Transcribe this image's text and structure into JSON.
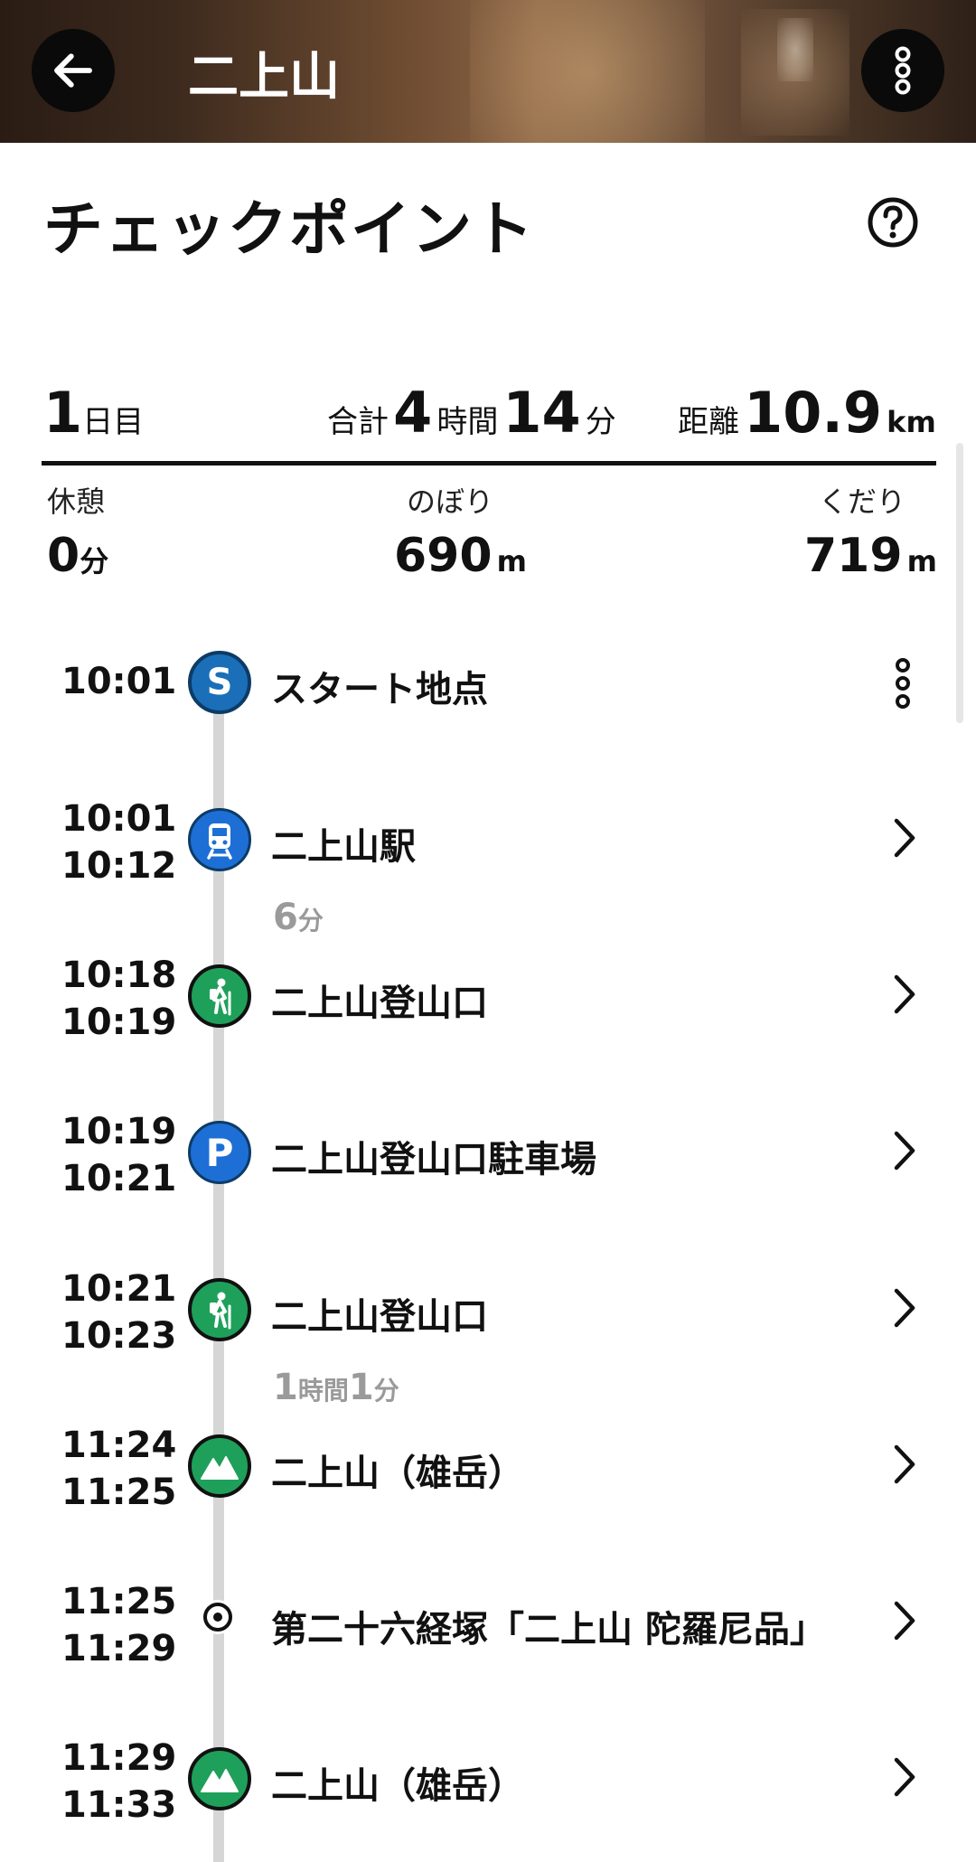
{
  "header": {
    "title": "二上山"
  },
  "page_title": "チェックポイント",
  "summary": {
    "day_number": "1",
    "day_unit": "日目",
    "total_label": "合計",
    "hours": "4",
    "hours_unit": "時間",
    "minutes": "14",
    "minutes_unit": "分",
    "distance_label": "距離",
    "distance": "10.9",
    "distance_unit": "km",
    "rest_label": "休憩",
    "rest_value": "0",
    "rest_unit": "分",
    "ascent_label": "のぼり",
    "ascent_value": "690",
    "ascent_unit": "m",
    "descent_label": "くだり",
    "descent_value": "719",
    "descent_unit": "m"
  },
  "checkpoints": [
    {
      "arrive": "10:01",
      "depart": "",
      "name": "スタート地点",
      "icon": "start-icon"
    },
    {
      "arrive": "10:01",
      "depart": "10:12",
      "name": "二上山駅",
      "icon": "train-icon"
    },
    {
      "arrive": "10:18",
      "depart": "10:19",
      "name": "二上山登山口",
      "icon": "hiker-icon"
    },
    {
      "arrive": "10:19",
      "depart": "10:21",
      "name": "二上山登山口駐車場",
      "icon": "parking-icon"
    },
    {
      "arrive": "10:21",
      "depart": "10:23",
      "name": "二上山登山口",
      "icon": "hiker-icon"
    },
    {
      "arrive": "11:24",
      "depart": "11:25",
      "name": "二上山（雄岳）",
      "icon": "mountain-icon"
    },
    {
      "arrive": "11:25",
      "depart": "11:29",
      "name": "第二十六経塚「二上山 陀羅尼品」",
      "icon": "point-icon"
    },
    {
      "arrive": "11:29",
      "depart": "11:33",
      "name": "二上山（雄岳）",
      "icon": "mountain-icon"
    }
  ],
  "durations": [
    {
      "n1": "6",
      "u1": "分",
      "n2": "",
      "u2": ""
    },
    {
      "n1": "1",
      "u1": "時間",
      "n2": "1",
      "u2": "分"
    }
  ],
  "colors": {
    "blue": "#1d6fd6",
    "start_blue": "#1a6fb8",
    "green": "#1fa05a",
    "timeline": "#d6d6d6"
  }
}
